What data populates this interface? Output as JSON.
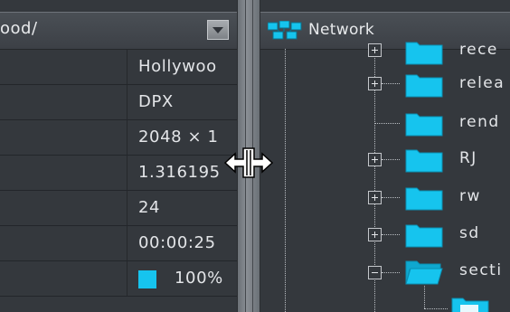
{
  "left_panel": {
    "path_text": "ood/",
    "rows": [
      {
        "value": "Hollywoo"
      },
      {
        "value": "DPX"
      },
      {
        "value": "2048 × 1"
      },
      {
        "value": "1.316195"
      },
      {
        "value": "24"
      },
      {
        "value": "00:00:25"
      }
    ],
    "percent": {
      "text": "100%",
      "swatch_color": "#16c4ee"
    }
  },
  "right_panel": {
    "title": "Network",
    "title_icon": "network-icon",
    "tree": [
      {
        "label": "rece",
        "expander": "plus",
        "icon": "folder-icon"
      },
      {
        "label": "relea",
        "expander": "plus",
        "icon": "folder-icon"
      },
      {
        "label": "rend",
        "expander": "none",
        "icon": "folder-icon"
      },
      {
        "label": "RJ",
        "expander": "plus",
        "icon": "folder-icon"
      },
      {
        "label": "rw",
        "expander": "plus",
        "icon": "folder-icon"
      },
      {
        "label": "sd",
        "expander": "plus",
        "icon": "folder-icon"
      },
      {
        "label": "secti",
        "expander": "minus",
        "icon": "folder-open-icon"
      },
      {
        "label": "",
        "expander": "none",
        "icon": "folder-icon"
      }
    ]
  },
  "cursor_icon": "horizontal-resize-cursor-icon",
  "colors": {
    "accent": "#16c4ee",
    "panel_bg": "#34383d",
    "splitter": "#7c8187"
  }
}
